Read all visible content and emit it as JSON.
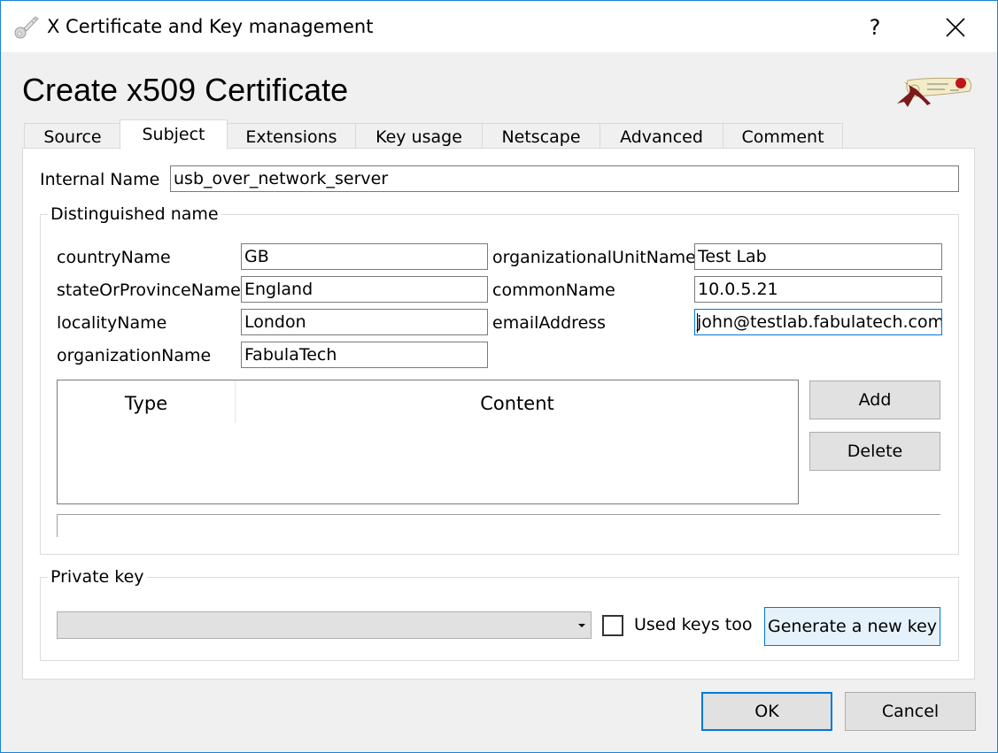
{
  "window": {
    "title": "X Certificate and Key management",
    "help_label": "?",
    "icons": {
      "app": "key-icon",
      "help": "help-icon",
      "close": "close-icon",
      "logo": "certificate-scroll-logo"
    }
  },
  "dialog": {
    "heading": "Create x509 Certificate"
  },
  "tabs": [
    {
      "label": "Source",
      "active": false
    },
    {
      "label": "Subject",
      "active": true
    },
    {
      "label": "Extensions",
      "active": false
    },
    {
      "label": "Key usage",
      "active": false
    },
    {
      "label": "Netscape",
      "active": false
    },
    {
      "label": "Advanced",
      "active": false
    },
    {
      "label": "Comment",
      "active": false
    }
  ],
  "subject": {
    "internal_name": {
      "label": "Internal Name",
      "value": "usb_over_network_server"
    },
    "distinguished_name": {
      "title": "Distinguished name",
      "fields": {
        "countryName": {
          "label": "countryName",
          "value": "GB"
        },
        "stateOrProvinceName": {
          "label": "stateOrProvinceName",
          "value": "England"
        },
        "localityName": {
          "label": "localityName",
          "value": "London"
        },
        "organizationName": {
          "label": "organizationName",
          "value": "FabulaTech"
        },
        "organizationalUnitName": {
          "label": "organizationalUnitName",
          "value": "Test Lab"
        },
        "commonName": {
          "label": "commonName",
          "value": "10.0.5.21"
        },
        "emailAddress": {
          "label": "emailAddress",
          "value": "john@testlab.fabulatech.com",
          "focused": true
        }
      },
      "table": {
        "columns": [
          "Type",
          "Content"
        ],
        "rows": []
      },
      "add_label": "Add",
      "delete_label": "Delete"
    },
    "private_key": {
      "title": "Private key",
      "selected": "",
      "used_keys_label": "Used keys too",
      "used_keys_checked": false,
      "generate_label": "Generate a new key"
    }
  },
  "footer": {
    "ok_label": "OK",
    "cancel_label": "Cancel"
  },
  "colors": {
    "accent": "#0078d7",
    "window_border": "#1883d7",
    "background": "#f0f0f0"
  }
}
